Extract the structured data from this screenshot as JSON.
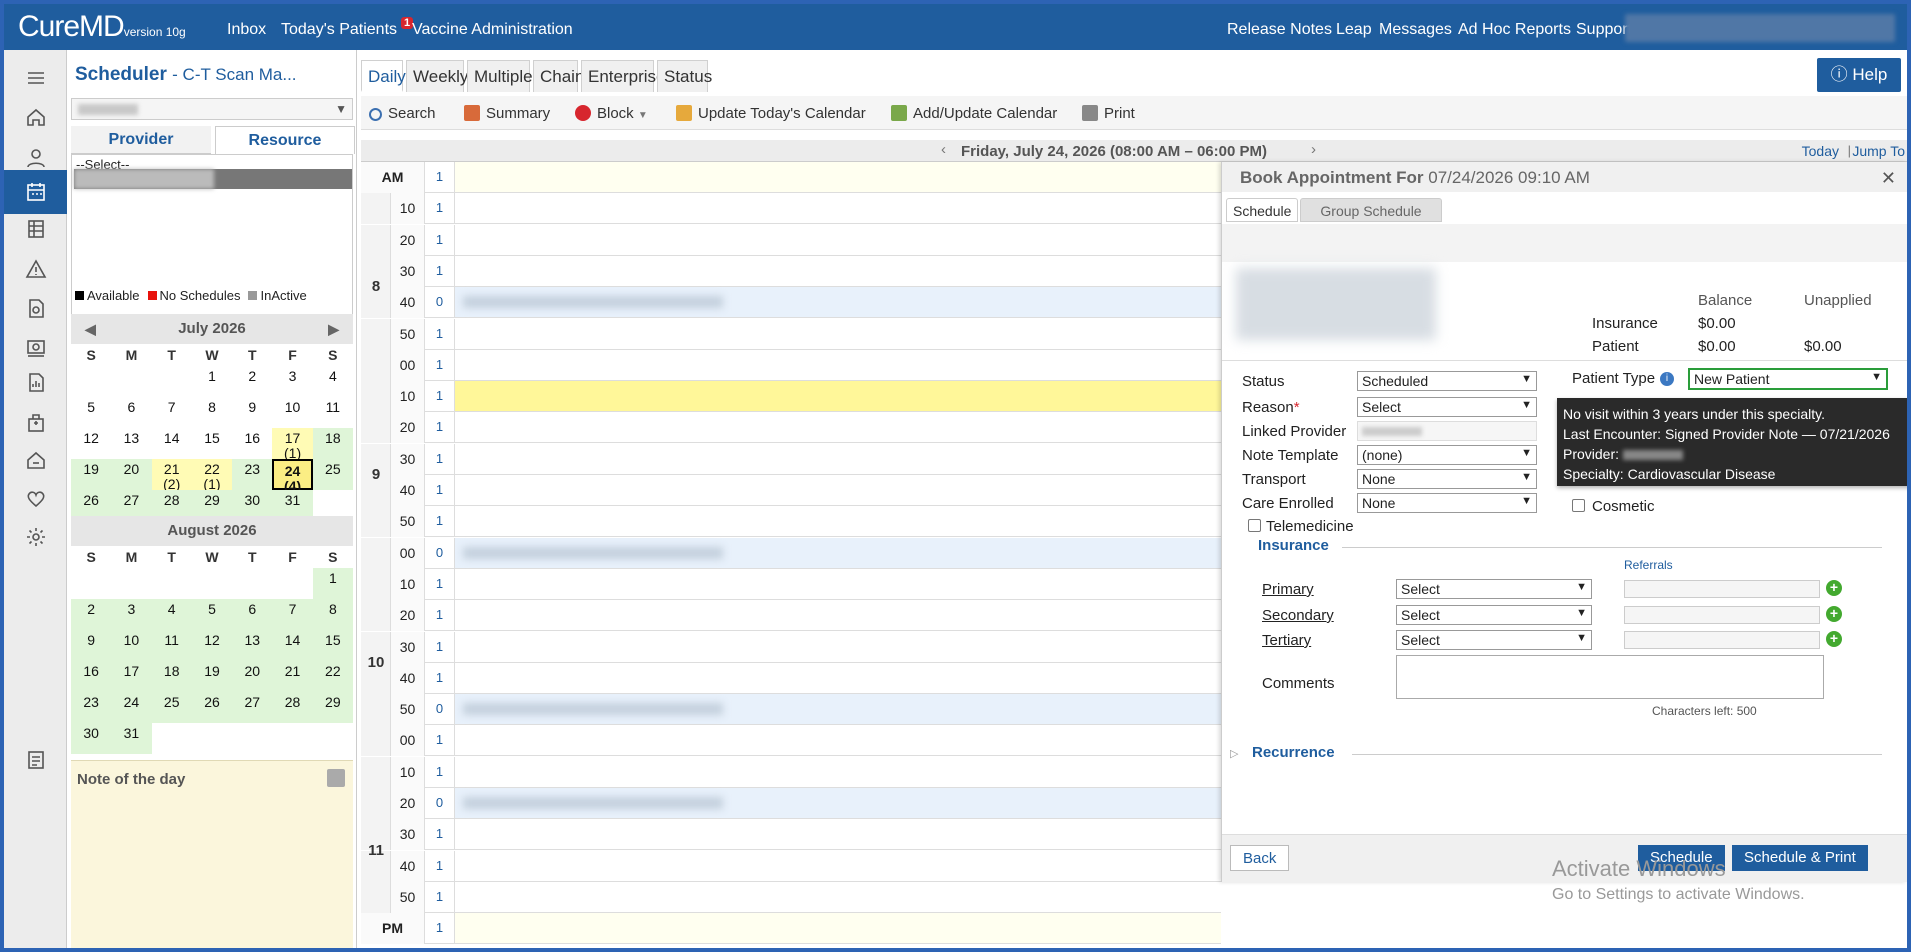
{
  "app": {
    "logo": "CureMD",
    "version": "version 10g"
  },
  "topnav": {
    "left": [
      "Inbox",
      "Today's Patients",
      "Vaccine Administration"
    ],
    "badge": "1",
    "right": [
      "Release Notes",
      "Leap",
      "Messages",
      "Ad Hoc Reports",
      "Support"
    ]
  },
  "sidebar_icons": [
    "menu-icon",
    "home-icon",
    "user-icon",
    "calendar-icon",
    "table-icon",
    "alert-icon",
    "document-icon",
    "billing-icon",
    "report-icon",
    "building-icon",
    "house-icon",
    "heart-icon",
    "gear-icon",
    "list-icon"
  ],
  "left": {
    "title": "Scheduler",
    "subtitle": "- C-T Scan Ma...",
    "tabs": [
      "Provider",
      "Resource"
    ],
    "list_first": "--Select--",
    "legend": [
      {
        "label": "Available",
        "color": "#000000"
      },
      {
        "label": "No Schedules",
        "color": "#e8120c"
      },
      {
        "label": "InActive",
        "color": "#999999"
      }
    ],
    "dow": [
      "S",
      "M",
      "T",
      "W",
      "T",
      "F",
      "S"
    ],
    "july": {
      "title": "July 2026",
      "cells": [
        [
          "",
          ""
        ],
        [
          "",
          ""
        ],
        [
          "",
          ""
        ],
        [
          "1",
          ""
        ],
        [
          "2",
          ""
        ],
        [
          "3",
          ""
        ],
        [
          "4",
          ""
        ],
        [
          "5",
          ""
        ],
        [
          "6",
          ""
        ],
        [
          "7",
          ""
        ],
        [
          "8",
          ""
        ],
        [
          "9",
          ""
        ],
        [
          "10",
          ""
        ],
        [
          "11",
          ""
        ],
        [
          "12",
          ""
        ],
        [
          "13",
          ""
        ],
        [
          "14",
          ""
        ],
        [
          "15",
          ""
        ],
        [
          "16",
          ""
        ],
        [
          "17\n(1)",
          "y"
        ],
        [
          "18",
          "g"
        ],
        [
          "19",
          "g"
        ],
        [
          "20",
          "g"
        ],
        [
          "21\n(2)",
          "y"
        ],
        [
          "22\n(1)",
          "y"
        ],
        [
          "23",
          "g"
        ],
        [
          "24\n(4)",
          "sel"
        ],
        [
          "25",
          "g"
        ],
        [
          "26",
          "g"
        ],
        [
          "27",
          "g"
        ],
        [
          "28",
          "g"
        ],
        [
          "29",
          "g"
        ],
        [
          "30",
          "g"
        ],
        [
          "31",
          "g"
        ],
        [
          "",
          ""
        ]
      ]
    },
    "august": {
      "title": "August 2026",
      "cells": [
        [
          "",
          ""
        ],
        [
          "",
          ""
        ],
        [
          "",
          ""
        ],
        [
          "",
          ""
        ],
        [
          "",
          ""
        ],
        [
          "",
          ""
        ],
        [
          "1",
          "g"
        ],
        [
          "2",
          "g"
        ],
        [
          "3",
          "g"
        ],
        [
          "4",
          "g"
        ],
        [
          "5",
          "g"
        ],
        [
          "6",
          "g"
        ],
        [
          "7",
          "g"
        ],
        [
          "8",
          "g"
        ],
        [
          "9",
          "g"
        ],
        [
          "10",
          "g"
        ],
        [
          "11",
          "g"
        ],
        [
          "12",
          "g"
        ],
        [
          "13",
          "g"
        ],
        [
          "14",
          "g"
        ],
        [
          "15",
          "g"
        ],
        [
          "16",
          "g"
        ],
        [
          "17",
          "g"
        ],
        [
          "18",
          "g"
        ],
        [
          "19",
          "g"
        ],
        [
          "20",
          "g"
        ],
        [
          "21",
          "g"
        ],
        [
          "22",
          "g"
        ],
        [
          "23",
          "g"
        ],
        [
          "24",
          "g"
        ],
        [
          "25",
          "g"
        ],
        [
          "26",
          "g"
        ],
        [
          "27",
          "g"
        ],
        [
          "28",
          "g"
        ],
        [
          "29",
          "g"
        ],
        [
          "30",
          "g"
        ],
        [
          "31",
          "g"
        ]
      ]
    },
    "note_title": "Note of the day"
  },
  "tabs": [
    "Daily",
    "Weekly",
    "Multiple",
    "Chain",
    "Enterprise",
    "Status"
  ],
  "toolbar": [
    "Search",
    "Summary",
    "Block",
    "Update Today's Calendar",
    "Add/Update Calendar",
    "Print"
  ],
  "datebar": {
    "date": "Friday, July 24, 2026 (08:00 AM – 06:00 PM)",
    "today": "Today",
    "jump": "Jump To",
    "sep": "|"
  },
  "help": "Help",
  "grid": {
    "hours": [
      {
        "label": "8",
        "rows": [
          1,
          6
        ]
      },
      {
        "label": "9",
        "rows": [
          7,
          12
        ]
      },
      {
        "label": "10",
        "rows": [
          13,
          18
        ]
      },
      {
        "label": "11",
        "rows": [
          19,
          24
        ]
      }
    ],
    "rows": [
      [
        "AM",
        "1",
        "cream"
      ],
      [
        "10",
        "1",
        ""
      ],
      [
        "20",
        "1",
        ""
      ],
      [
        "30",
        "1",
        ""
      ],
      [
        "40",
        "0",
        "b"
      ],
      [
        "50",
        "1",
        ""
      ],
      [
        "00",
        "1",
        ""
      ],
      [
        "10",
        "1",
        "yel"
      ],
      [
        "20",
        "1",
        ""
      ],
      [
        "30",
        "1",
        ""
      ],
      [
        "40",
        "1",
        ""
      ],
      [
        "50",
        "1",
        ""
      ],
      [
        "00",
        "0",
        "b"
      ],
      [
        "10",
        "1",
        ""
      ],
      [
        "20",
        "1",
        ""
      ],
      [
        "30",
        "1",
        ""
      ],
      [
        "40",
        "1",
        ""
      ],
      [
        "50",
        "0",
        "b"
      ],
      [
        "00",
        "1",
        ""
      ],
      [
        "10",
        "1",
        ""
      ],
      [
        "20",
        "0",
        "b"
      ],
      [
        "30",
        "1",
        ""
      ],
      [
        "40",
        "1",
        ""
      ],
      [
        "50",
        "1",
        ""
      ],
      [
        "PM",
        "1",
        "cream"
      ]
    ]
  },
  "modal": {
    "title_prefix": "Book Appointment For",
    "title_date": "07/24/2026 09:10 AM",
    "tabs": [
      "Schedule",
      "Group Schedule"
    ],
    "balance": {
      "headers": [
        "Balance",
        "Unapplied"
      ],
      "rows": [
        {
          "label": "Insurance",
          "balance": "$0.00",
          "unapplied": ""
        },
        {
          "label": "Patient",
          "balance": "$0.00",
          "unapplied": "$0.00"
        }
      ]
    },
    "fields": [
      {
        "label": "Status",
        "value": "Scheduled"
      },
      {
        "label": "Reason",
        "value": "Select",
        "required": "*"
      },
      {
        "label": "Linked Provider",
        "value": ""
      },
      {
        "label": "Note Template",
        "value": "(none)"
      },
      {
        "label": "Transport",
        "value": "None"
      },
      {
        "label": "Care Enrolled",
        "value": "None"
      }
    ],
    "patient_type": {
      "label": "Patient Type",
      "value": "New Patient"
    },
    "tooltip": [
      "No visit within 3 years under this specialty.",
      "Last Encounter: Signed Provider Note — 07/21/2026",
      "Provider:",
      "Specialty: Cardiovascular Disease"
    ],
    "cosmetic": "Cosmetic",
    "telemedicine": "Telemedicine",
    "insurance": {
      "title": "Insurance",
      "referrals": "Referrals",
      "rows": [
        {
          "label": "Primary",
          "value": "Select"
        },
        {
          "label": "Secondary",
          "value": "Select"
        },
        {
          "label": "Tertiary",
          "value": "Select"
        }
      ]
    },
    "comments": "Comments",
    "chars_left": "Characters left: 500",
    "recurrence": "Recurrence",
    "buttons": {
      "back": "Back",
      "schedule": "Schedule",
      "schedule_print": "Schedule & Print"
    }
  },
  "watermark": [
    "Activate Windows",
    "Go to Settings to activate Windows."
  ]
}
